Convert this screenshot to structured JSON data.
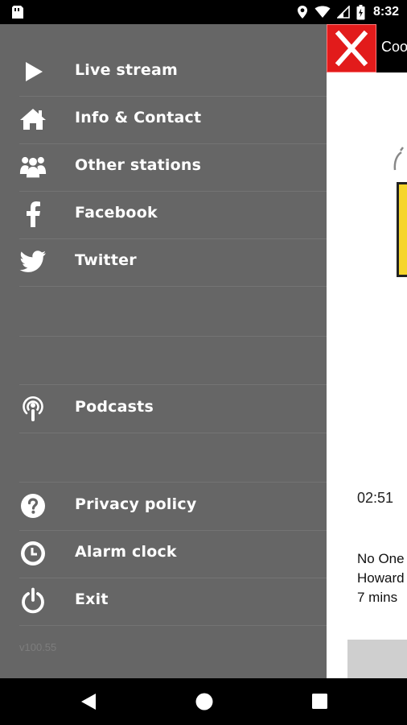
{
  "status_bar": {
    "time": "8:32",
    "icons": [
      "sim-card-icon",
      "location-icon",
      "wifi-icon",
      "signal-icon",
      "battery-icon"
    ]
  },
  "app": {
    "header_title": "Coo",
    "now_playing": {
      "elapsed": "02:51",
      "line1": "No One",
      "line2": "Howard",
      "line3": "7 mins"
    },
    "colors": {
      "close_button": "#e21b1b",
      "header": "#000000",
      "art_yellow": "#f6d52b"
    }
  },
  "drawer": {
    "background": "#666666",
    "items": [
      {
        "label": "Live stream",
        "icon": "play-icon"
      },
      {
        "label": "Info & Contact",
        "icon": "home-icon"
      },
      {
        "label": "Other stations",
        "icon": "group-icon"
      },
      {
        "label": "Facebook",
        "icon": "facebook-icon"
      },
      {
        "label": "Twitter",
        "icon": "twitter-icon"
      },
      {
        "label": "Podcasts",
        "icon": "podcast-icon"
      },
      {
        "label": "Privacy policy",
        "icon": "help-icon"
      },
      {
        "label": "Alarm clock",
        "icon": "clock-icon"
      },
      {
        "label": "Exit",
        "icon": "power-icon"
      }
    ],
    "version": "v100.55"
  },
  "nav_bar": {
    "buttons": [
      "back-icon",
      "home-circle-icon",
      "recents-icon"
    ]
  }
}
